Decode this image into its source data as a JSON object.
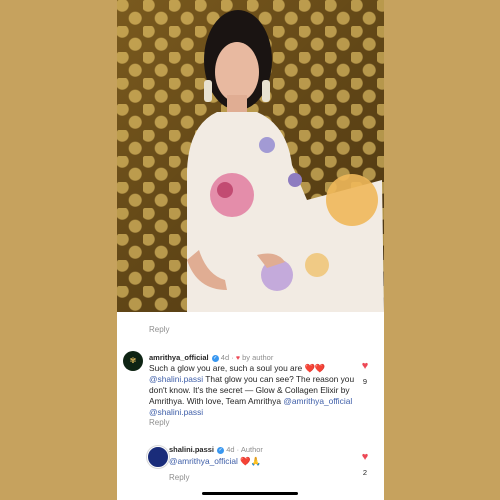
{
  "post": {
    "reply_label": "Reply"
  },
  "comments": [
    {
      "username": "amrithya_official",
      "time": "4d",
      "by_label": "by author",
      "avatar_icon": "amrithya-logo",
      "text_a": "Such a glow you are, such a soul you are ",
      "emoji_a": "❤️❤️",
      "mention_a": "@shalini.passi",
      "text_b": " That glow you can see? The reason you don't know. It's the secret — Glow & Collagen Elixir by Amrithya. With love, Team Amrithya ",
      "mention_b": "@amrithya_official",
      "mention_c": "@shalini.passi",
      "reply_label": "Reply",
      "likes": "9"
    },
    {
      "username": "shalini.passi",
      "time": "4d",
      "author_label": "Author",
      "mention": "@amrithya_official",
      "emoji": "❤️🙏",
      "reply_label": "Reply",
      "likes": "2"
    }
  ],
  "colors": {
    "background": "#c6a25e",
    "like": "#ed4956",
    "mention": "#3e5ea8",
    "verified": "#3897f0"
  }
}
